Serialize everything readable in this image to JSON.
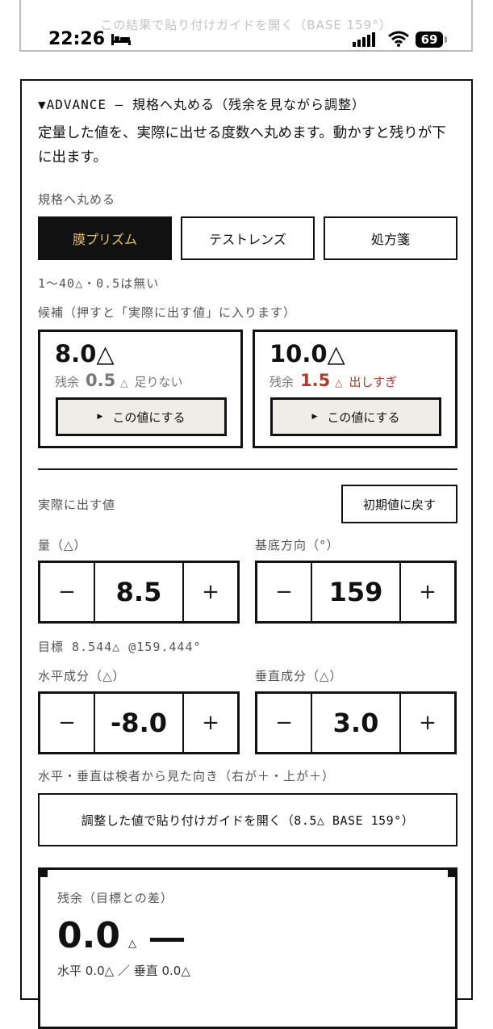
{
  "status_bar": {
    "time": "22:26",
    "battery": "69",
    "icons": [
      "bed-icon",
      "signal-icon",
      "wifi-icon",
      "battery-icon"
    ]
  },
  "sticky_link": "この結果で貼り付けガイドを開く（BASE 159°）",
  "advance": {
    "title": "▼ADVANCE — 規格へ丸める（残余を見ながら調整）",
    "description": "定量した値を、実際に出せる度数へ丸めます。動かすと残りが下に出ます。",
    "round_label": "規格へ丸める",
    "tabs": [
      "膜プリズム",
      "テストレンズ",
      "処方箋"
    ],
    "active_tab": 0,
    "range_note": "1〜40△・0.5は無い",
    "candidates_label": "候補（押すと「実際に出す値」に入ります）",
    "candidates": [
      {
        "value": "8.0△",
        "residual_label": "残余",
        "residual": "0.5",
        "unit": "△",
        "note": "足りない",
        "button": "この値にする"
      },
      {
        "value": "10.0△",
        "residual_label": "残余",
        "residual": "1.5",
        "unit": "△",
        "note": "出しすぎ",
        "button": "この値にする"
      }
    ]
  },
  "actual": {
    "label": "実際に出す値",
    "reset_button": "初期値に戻す",
    "amount": {
      "label": "量（△）",
      "value": "8.5",
      "minus": "−",
      "plus": "+"
    },
    "base": {
      "label": "基底方向（°）",
      "value": "159",
      "minus": "−",
      "plus": "+"
    },
    "target": "目標 8.544△ @159.444°",
    "horizontal": {
      "label": "水平成分（△）",
      "value": "-8.0",
      "minus": "−",
      "plus": "+"
    },
    "vertical": {
      "label": "垂直成分（△）",
      "value": "3.0",
      "minus": "−",
      "plus": "+"
    },
    "orientation_note": "水平・垂直は検者から見た向き（右が＋・上が＋）",
    "open_guide_button": "調整した値で貼り付けガイドを開く（8.5△ BASE 159°）"
  },
  "result": {
    "label": "残余（目標との差）",
    "value": "0.0",
    "unit": "△",
    "sub": "水平 0.0△ ／ 垂直 0.0△"
  },
  "colors": {
    "accent": "#e8c05a",
    "warning": "#b03a2a",
    "button_bg": "#efede8",
    "border": "#111111"
  }
}
